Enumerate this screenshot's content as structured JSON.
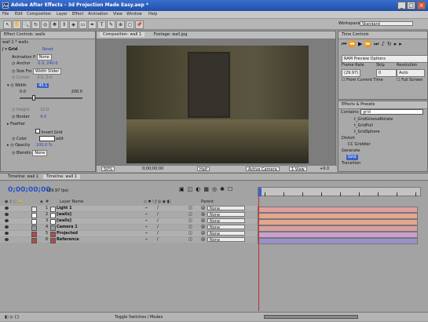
{
  "window": {
    "title": "Adobe After Effects - 3d Projection Made Easy.aep *",
    "app_icon": "Ae",
    "minimize_glyph": "_",
    "maximize_glyph": "□",
    "close_glyph": "×"
  },
  "menu": [
    "File",
    "Edit",
    "Composition",
    "Layer",
    "Effect",
    "Animation",
    "View",
    "Window",
    "Help"
  ],
  "toolbar": {
    "tools": [
      "selection-tool-icon",
      "hand-tool-icon",
      "zoom-tool-icon",
      "rotate-tool-icon",
      "orbit-camera-icon",
      "track-xy-camera-icon",
      "track-z-camera-icon",
      "pan-behind-icon",
      "rectangle-mask-icon",
      "pen-tool-icon",
      "type-tool-icon",
      "brush-tool-icon",
      "clone-stamp-icon",
      "eraser-icon",
      "puppet-pin-icon"
    ],
    "tool_glyphs": [
      "↖",
      "✋",
      "🔍",
      "↻",
      "◎",
      "✥",
      "⇕",
      "◈",
      "▭",
      "✒",
      "T",
      "✎",
      "⊕",
      "◻",
      "📌"
    ],
    "workspace_label": "Workspace:",
    "workspace_value": "Standard"
  },
  "effect_controls": {
    "tab": "Effect Controls: walls",
    "subtitle": "wall 1 * walls",
    "effect_name": "Grid",
    "reset_label": "Reset",
    "rows": [
      {
        "label": "Animation P",
        "value": "None"
      },
      {
        "label": "Anchor",
        "value": "0.0, 240.0"
      },
      {
        "label": "Size Fro",
        "value": "Width Slider"
      },
      {
        "label": "Corner",
        "value": "0.0, 0.0"
      },
      {
        "label": "Width",
        "value": "45.1"
      },
      {
        "label": "Height",
        "value": "10.0"
      },
      {
        "label": "Border",
        "value": "6.0"
      },
      {
        "label": "Feather",
        "value": ""
      },
      {
        "label": "Invert Grid",
        "value": ""
      },
      {
        "label": "Color",
        "value": ""
      },
      {
        "label": "Opacity",
        "value": "100.0 %"
      },
      {
        "label": "Blendin",
        "value": "None"
      }
    ],
    "slider_min": "0.0",
    "slider_max": "200.0",
    "width_slider_level": 0.22,
    "color_swatch": "#ffffff",
    "color_edit_label": "edit"
  },
  "composition": {
    "tab1": "Composition: wall 1",
    "tab2": "Footage: wall.jpg",
    "zoom": "50%",
    "timecode": "0;00;00;00",
    "resolution": "Half",
    "camera": "Active Camera",
    "views": "1 View",
    "bottom_value": "+0.0"
  },
  "time_controls": {
    "tab": "Time Controls",
    "ram_preview": "RAM Preview Options",
    "frame_rate_label": "Frame Rate",
    "skip_label": "Skip",
    "resolution_label": "Resolution",
    "frame_rate_value": "(29.97)",
    "skip_value": "0",
    "resolution_value": "Auto",
    "from_current_label": "From Current Time",
    "full_screen_label": "Full Screen"
  },
  "effects_presets": {
    "tab": "Effects & Presets",
    "contains_label": "Contains:",
    "search_value": "grid",
    "items": [
      {
        "text": "t_GridGrooveRotate",
        "indent": 2,
        "selected": false
      },
      {
        "text": "t_GridPull",
        "indent": 2,
        "selected": false
      },
      {
        "text": "t_GridSphere",
        "indent": 2,
        "selected": false
      },
      {
        "text": "Distort",
        "indent": 0,
        "selected": false
      },
      {
        "text": "CC Griddler",
        "indent": 1,
        "selected": false
      },
      {
        "text": "Generate",
        "indent": 0,
        "selected": false
      },
      {
        "text": "Grid",
        "indent": 1,
        "selected": true
      },
      {
        "text": "Transition",
        "indent": 0,
        "selected": false
      }
    ]
  },
  "timeline": {
    "tab1": "Timeline: wall 1",
    "tab2": "Timeline: wall 1",
    "timecode": "0;00;00;00",
    "fps": "(29.97 fps)",
    "col_layer_name": "Layer Name",
    "col_parent": "Parent",
    "col_number": "#",
    "layers": [
      {
        "num": "1",
        "name": "Light 1",
        "parent": "None",
        "color": "#e8e8e8",
        "track": "#e0a0a0"
      },
      {
        "num": "2",
        "name": "[walls]",
        "parent": "None",
        "color": "#ffffff",
        "track": "#e5a68f"
      },
      {
        "num": "3",
        "name": "[walls]",
        "parent": "None",
        "color": "#ffffff",
        "track": "#e5a68f"
      },
      {
        "num": "4",
        "name": "Camera 1",
        "parent": "None",
        "color": "#999999",
        "track": "#d9a0a0"
      },
      {
        "num": "5",
        "name": "Projected",
        "parent": "None",
        "color": "#b44a4a",
        "track": "#c8a0d0"
      },
      {
        "num": "6",
        "name": "Reference",
        "parent": "None",
        "color": "#b44a4a",
        "track": "#9d8fc8"
      }
    ],
    "bottom_label": "Toggle Switches / Modes",
    "ruler_marks": [
      "0s",
      "01s",
      "02s",
      "03s",
      "04s",
      "05s",
      "06s",
      "07s",
      "08s"
    ]
  }
}
